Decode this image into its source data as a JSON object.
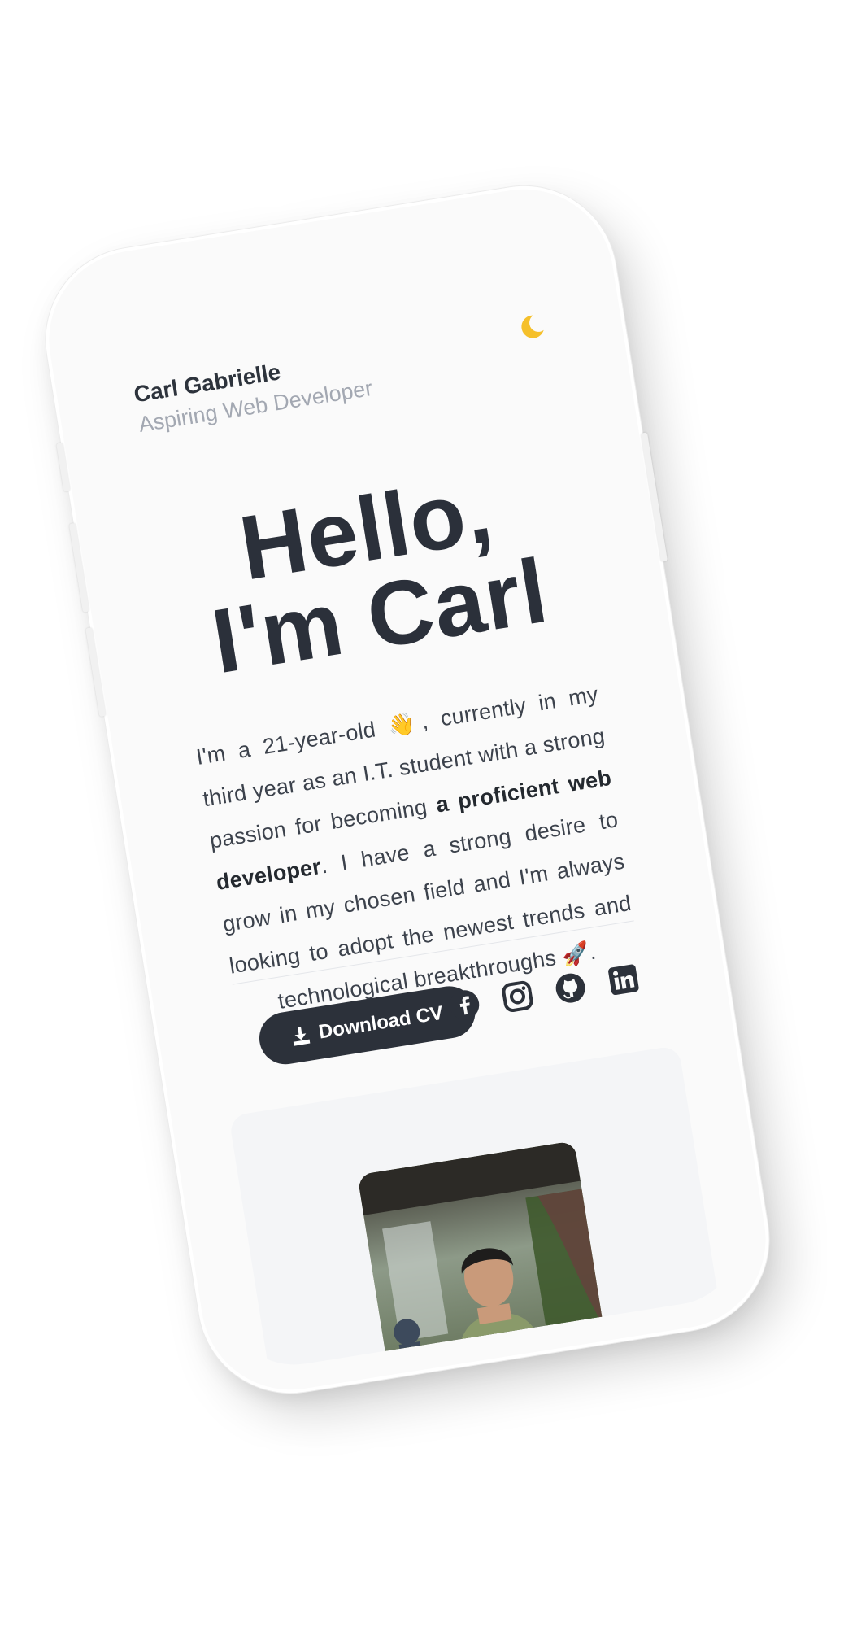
{
  "header": {
    "name": "Carl Gabrielle",
    "role": "Aspiring Web Developer",
    "theme_toggle_icon": "moon-icon"
  },
  "hero": {
    "title_line1": "Hello,",
    "title_line2": "I'm Carl"
  },
  "intro": {
    "part1": "I'm a 21-year-old ",
    "emoji1": "👋",
    "part2": ", currently in my third year as an I.T. student with a strong passion for becoming ",
    "highlight": "a proficient web developer",
    "part3": ". I have a strong desire to grow in my chosen field and I'm always looking to adopt the newest trends and technological breakthroughs ",
    "emoji2": "🚀",
    "part4": "."
  },
  "actions": {
    "download_label": "Download CV",
    "download_icon": "download-icon"
  },
  "socials": [
    {
      "name": "facebook",
      "icon": "facebook-icon"
    },
    {
      "name": "instagram",
      "icon": "instagram-icon"
    },
    {
      "name": "github",
      "icon": "github-icon"
    },
    {
      "name": "linkedin",
      "icon": "linkedin-icon"
    }
  ],
  "colors": {
    "primary_text": "#2b303a",
    "muted_text": "#a3a8b2",
    "button_bg": "#2c313a",
    "accent_moon": "#f5c02b",
    "background": "#fafafa"
  }
}
